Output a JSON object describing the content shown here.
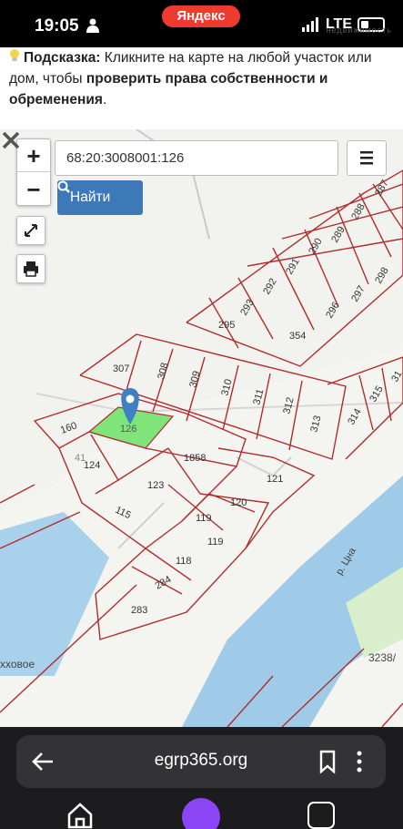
{
  "status": {
    "time": "19:05",
    "yandex": "Яндекс",
    "network": "LTE",
    "watermark": "недвижимость"
  },
  "hint": {
    "prefix": "Подсказка:",
    "text1": " Кликните на карте на любой участок или дом, чтобы ",
    "emph": "проверить права собственности и обременения",
    "suffix": "."
  },
  "map": {
    "zoom_in": "+",
    "zoom_out": "−",
    "search_value": "68:20:3008001:126",
    "find_label": "Найти",
    "selected_parcel": "126",
    "river_label": "р. Цна",
    "place_label": "хховое",
    "bottom_right_label": "3238/",
    "parcels": [
      "287",
      "288",
      "289",
      "290",
      "291",
      "292",
      "293",
      "295",
      "296",
      "297",
      "298",
      "354",
      "307",
      "308",
      "309",
      "310",
      "311",
      "312",
      "313",
      "314",
      "315",
      "31",
      "160",
      "41",
      "124",
      "1858",
      "123",
      "121",
      "115",
      "120",
      "119",
      "119",
      "118",
      "284",
      "283"
    ],
    "highlight_color": "#7fe57a",
    "parcel_color": "#b12c2c",
    "water_color": "#9fcbe8"
  },
  "browser": {
    "url": "egrp365.org"
  }
}
